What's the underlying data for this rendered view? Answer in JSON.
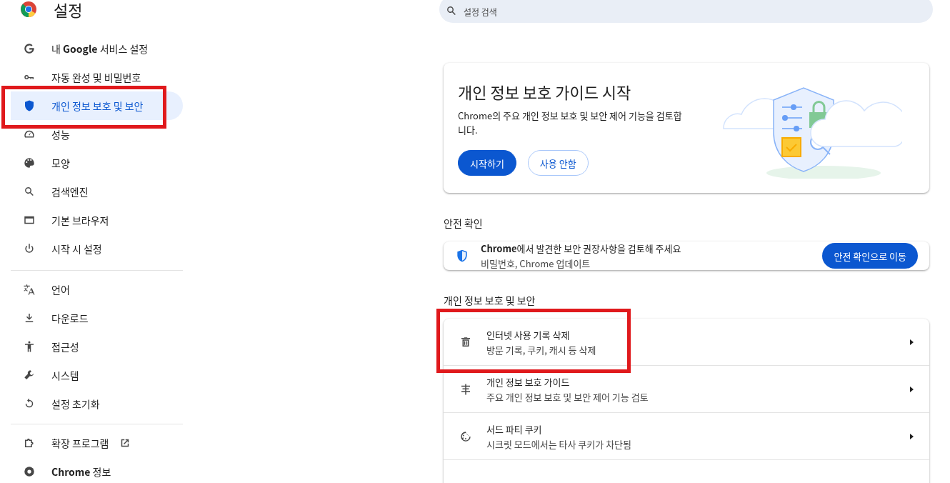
{
  "header": {
    "title": "설정"
  },
  "search": {
    "placeholder": "설정 검색"
  },
  "sidebar": {
    "groups": [
      {
        "items": [
          {
            "label": "내 **Google** 서비스 설정",
            "selected": false,
            "highlighted": false
          },
          {
            "label": "자동 완성 및 비밀번호",
            "selected": false,
            "highlighted": false
          },
          {
            "label": "개인 정보 보호 및 보안",
            "selected": true,
            "highlighted": true
          },
          {
            "label": "성능",
            "selected": false,
            "highlighted": false
          },
          {
            "label": "모양",
            "selected": false,
            "highlighted": false
          },
          {
            "label": "검색엔진",
            "selected": false,
            "highlighted": false
          },
          {
            "label": "기본 브라우저",
            "selected": false,
            "highlighted": false
          },
          {
            "label": "시작 시 설정",
            "selected": false,
            "highlighted": false
          }
        ]
      },
      {
        "items": [
          {
            "label": "언어",
            "selected": false,
            "highlighted": false
          },
          {
            "label": "다운로드",
            "selected": false,
            "highlighted": false
          },
          {
            "label": "접근성",
            "selected": false,
            "highlighted": false
          },
          {
            "label": "시스템",
            "selected": false,
            "highlighted": false
          },
          {
            "label": "설정 초기화",
            "selected": false,
            "highlighted": false
          }
        ]
      },
      {
        "items": [
          {
            "label": "확장 프로그램",
            "selected": false,
            "highlighted": false,
            "external": true
          },
          {
            "label": "**Chrome** 정보",
            "selected": false,
            "highlighted": false,
            "external": false
          }
        ]
      }
    ]
  },
  "guide_card": {
    "title": "개인 정보 보호 가이드 시작",
    "description": "Chrome의 주요 개인 정보 보호 및 보안 제어 기능을 검토합니다.",
    "buttons": [
      {
        "label": "시작하기",
        "kind": "primary"
      },
      {
        "label": "사용 안함",
        "kind": "outline"
      }
    ]
  },
  "safety_check": {
    "heading": "안전 확인",
    "title": "**Chrome**에서 발견한 보안 권장사항을 검토해 주세요",
    "subtitle": "비밀번호, Chrome 업데이트",
    "button": "안전 확인으로 이동"
  },
  "privacy_section": {
    "heading": "개인 정보 보호 및 보안",
    "rows": [
      {
        "title": "인터넷 사용 기록 삭제",
        "subtitle": "방문 기록, 쿠키, 캐시 등 삭제",
        "highlighted": true
      },
      {
        "title": "개인 정보 보호 가이드",
        "subtitle": "주요 개인 정보 보호 및 보안 제어 기능 검토",
        "highlighted": false
      },
      {
        "title": "서드 파티 쿠키",
        "subtitle": "시크릿 모드에서는 타사 쿠키가 차단됨",
        "highlighted": false
      }
    ]
  }
}
